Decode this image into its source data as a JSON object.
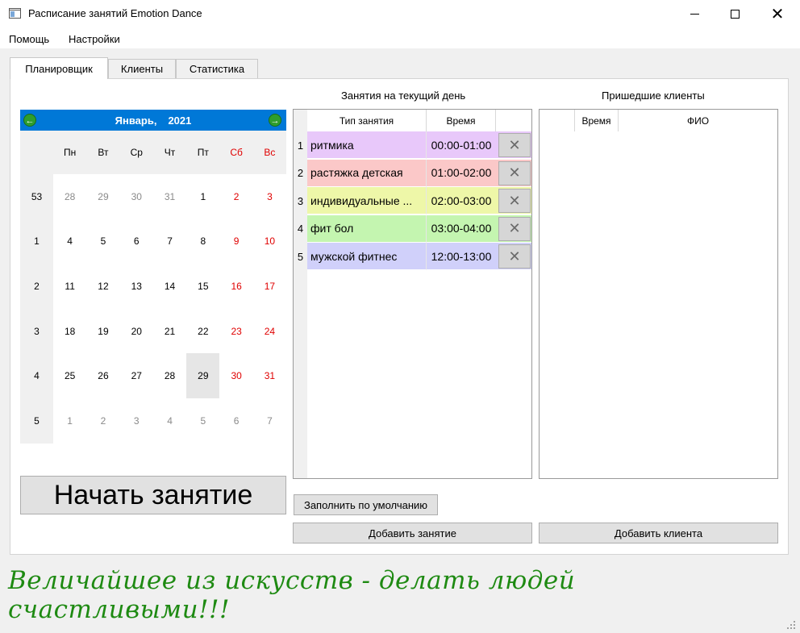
{
  "window": {
    "title": "Расписание занятий Emotion Dance",
    "minimize": "—",
    "maximize": "☐",
    "close": "✕"
  },
  "menu": [
    "Помощь",
    "Настройки"
  ],
  "tabs": [
    "Планировщик",
    "Клиенты",
    "Статистика"
  ],
  "active_tab": 0,
  "calendar": {
    "month": "Январь,",
    "year": "2021",
    "prev": "◀",
    "next": "▶",
    "weekdays": [
      "Пн",
      "Вт",
      "Ср",
      "Чт",
      "Пт",
      "Сб",
      "Вс"
    ],
    "weeks": [
      {
        "week": "53",
        "days": [
          "28",
          "29",
          "30",
          "31",
          "1",
          "2",
          "3"
        ]
      },
      {
        "week": "1",
        "days": [
          "4",
          "5",
          "6",
          "7",
          "8",
          "9",
          "10"
        ]
      },
      {
        "week": "2",
        "days": [
          "11",
          "12",
          "13",
          "14",
          "15",
          "16",
          "17"
        ]
      },
      {
        "week": "3",
        "days": [
          "18",
          "19",
          "20",
          "21",
          "22",
          "23",
          "24"
        ]
      },
      {
        "week": "4",
        "days": [
          "25",
          "26",
          "27",
          "28",
          "29",
          "30",
          "31"
        ]
      },
      {
        "week": "5",
        "days": [
          "1",
          "2",
          "3",
          "4",
          "5",
          "6",
          "7"
        ]
      }
    ],
    "selected": "29",
    "accent": "#0078d7",
    "weekend_color": "#e00000"
  },
  "start_button": "Начать занятие",
  "lessons": {
    "title": "Занятия на текущий день",
    "col_type": "Тип занятия",
    "col_time": "Время",
    "rows": [
      {
        "num": "1",
        "type": "ритмика",
        "time": "00:00-01:00",
        "color": "#e8c8fa"
      },
      {
        "num": "2",
        "type": "растяжка детская",
        "time": "01:00-02:00",
        "color": "#fbc8c8"
      },
      {
        "num": "3",
        "type": "индивидуальные ...",
        "time": "02:00-03:00",
        "color": "#eef7a8"
      },
      {
        "num": "4",
        "type": "фит бол",
        "time": "03:00-04:00",
        "color": "#c4f5b0"
      },
      {
        "num": "5",
        "type": "мужской фитнес",
        "time": "12:00-13:00",
        "color": "#d0d0fa"
      }
    ],
    "delete_glyph": "✕"
  },
  "clients": {
    "title": "Пришедшие клиенты",
    "col_time": "Время",
    "col_name": "ФИО"
  },
  "fill_default_button": "Заполнить по умолчанию",
  "add_lesson_button": "Добавить занятие",
  "add_client_button": "Добавить клиента",
  "motto": "Величайшее из искусств - делать людей счастливыми!!!",
  "motto_color": "#1e8a12"
}
